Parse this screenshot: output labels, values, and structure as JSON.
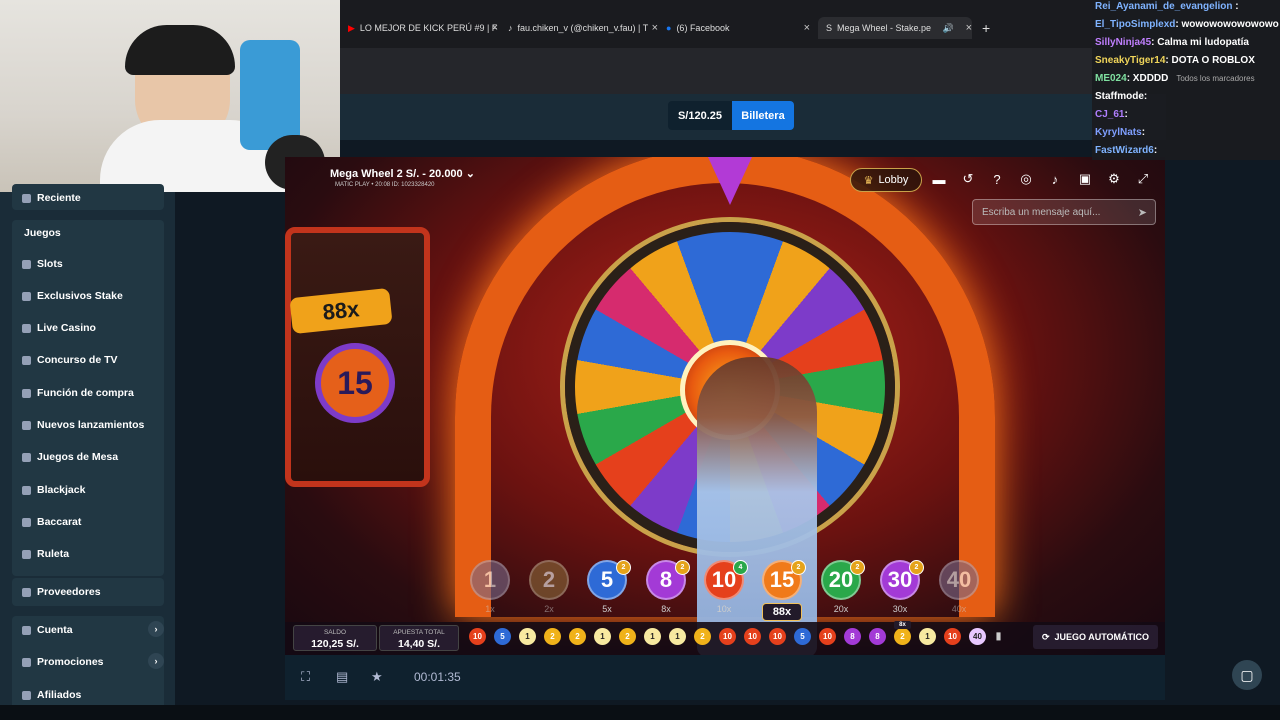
{
  "browser": {
    "tabs": [
      {
        "label": "LO MEJOR DE KICK PERÚ #9 | F",
        "icon": "youtube-icon"
      },
      {
        "label": "fau.chiken_v (@chiken_v.fau) | T",
        "icon": "tiktok-icon"
      },
      {
        "label": "(6) Facebook",
        "icon": "facebook-icon"
      },
      {
        "label": "Mega Wheel - Stake.pe",
        "icon": "stake-icon",
        "active": true
      }
    ],
    "new_tab": "+",
    "close": "×",
    "chat_overlay_label": "Todos los marcadores"
  },
  "header": {
    "balance": "S/120.25",
    "wallet": "Billetera"
  },
  "sidebar": {
    "items": [
      {
        "label": "Reciente"
      },
      {
        "label": "Juegos"
      },
      {
        "label": "Slots"
      },
      {
        "label": "Exclusivos Stake"
      },
      {
        "label": "Live Casino"
      },
      {
        "label": "Concurso de TV"
      },
      {
        "label": "Función de compra"
      },
      {
        "label": "Nuevos lanzamientos"
      },
      {
        "label": "Juegos de Mesa"
      },
      {
        "label": "Blackjack"
      },
      {
        "label": "Baccarat"
      },
      {
        "label": "Ruleta"
      },
      {
        "label": "Proveedores"
      },
      {
        "label": "Cuenta"
      },
      {
        "label": "Promociones"
      },
      {
        "label": "Afiliados"
      }
    ]
  },
  "game": {
    "title": "Mega Wheel 2 S/. - 20.000 ⌄",
    "subtitle": "MATIC PLAY • 20:08 ID: 1023328420",
    "lobby": "Lobby",
    "chat_placeholder": "Escriba un mensaje aquí...",
    "side_multiplier": "88x",
    "side_number": "15",
    "bets": [
      {
        "n": "1",
        "x": "1x",
        "color": "#7a6a8a"
      },
      {
        "n": "2",
        "x": "2x",
        "color": "#8a6a3a"
      },
      {
        "n": "5",
        "x": "5x",
        "color": "#2e6ad6",
        "chip": "2"
      },
      {
        "n": "8",
        "x": "8x",
        "color": "#a33ad6",
        "chip": "2"
      },
      {
        "n": "10",
        "x": "10x",
        "color": "#e5401c",
        "chip": "4"
      },
      {
        "n": "15",
        "x": "88x",
        "color": "#f07a1a",
        "chip": "2"
      },
      {
        "n": "20",
        "x": "20x",
        "color": "#2aa84a",
        "chip": "2"
      },
      {
        "n": "30",
        "x": "30x",
        "color": "#a33ad6",
        "chip": "2"
      },
      {
        "n": "40",
        "x": "40x",
        "color": "#7a6a8a"
      }
    ],
    "saldo_label": "SALDO",
    "saldo": "120,25 S/.",
    "apuesta_label": "APUESTA TOTAL",
    "apuesta": "14,40 S/.",
    "history": [
      "10",
      "5",
      "1",
      "2",
      "2",
      "1",
      "2",
      "1",
      "1",
      "2",
      "10",
      "10",
      "10",
      "5",
      "10",
      "8",
      "8",
      "2",
      "1",
      "10",
      "40"
    ],
    "history_tag": "8x",
    "auto": "JUEGO AUTOMÁTICO",
    "timer": "00:01:35"
  },
  "chat": [
    {
      "user": "Rei_Ayanami_de_evangelion",
      "msg": "",
      "color": "#7fb3ff"
    },
    {
      "user": "El_TipoSimplexd",
      "msg": ": wowowowowowowo",
      "color": "#7fb3ff"
    },
    {
      "user": "SillyNinja45",
      "msg": ": Calma mi ludopatía",
      "color": "#c07fff"
    },
    {
      "user": "SneakyTiger14",
      "msg": ": DOTA O ROBLOX",
      "color": "#f0d55a"
    },
    {
      "user": "ME024",
      "msg": ": XDDDD",
      "color": "#7fe0a0"
    },
    {
      "user": "Staffmode",
      "msg": ":",
      "color": "#ffffff"
    },
    {
      "user": "CJ_61",
      "msg": ":",
      "color": "#b07fff"
    },
    {
      "user": "KyrylNats",
      "msg": ":",
      "color": "#7f9fff"
    },
    {
      "user": "FastWizard6",
      "msg": ":",
      "color": "#7fb3ff"
    }
  ]
}
